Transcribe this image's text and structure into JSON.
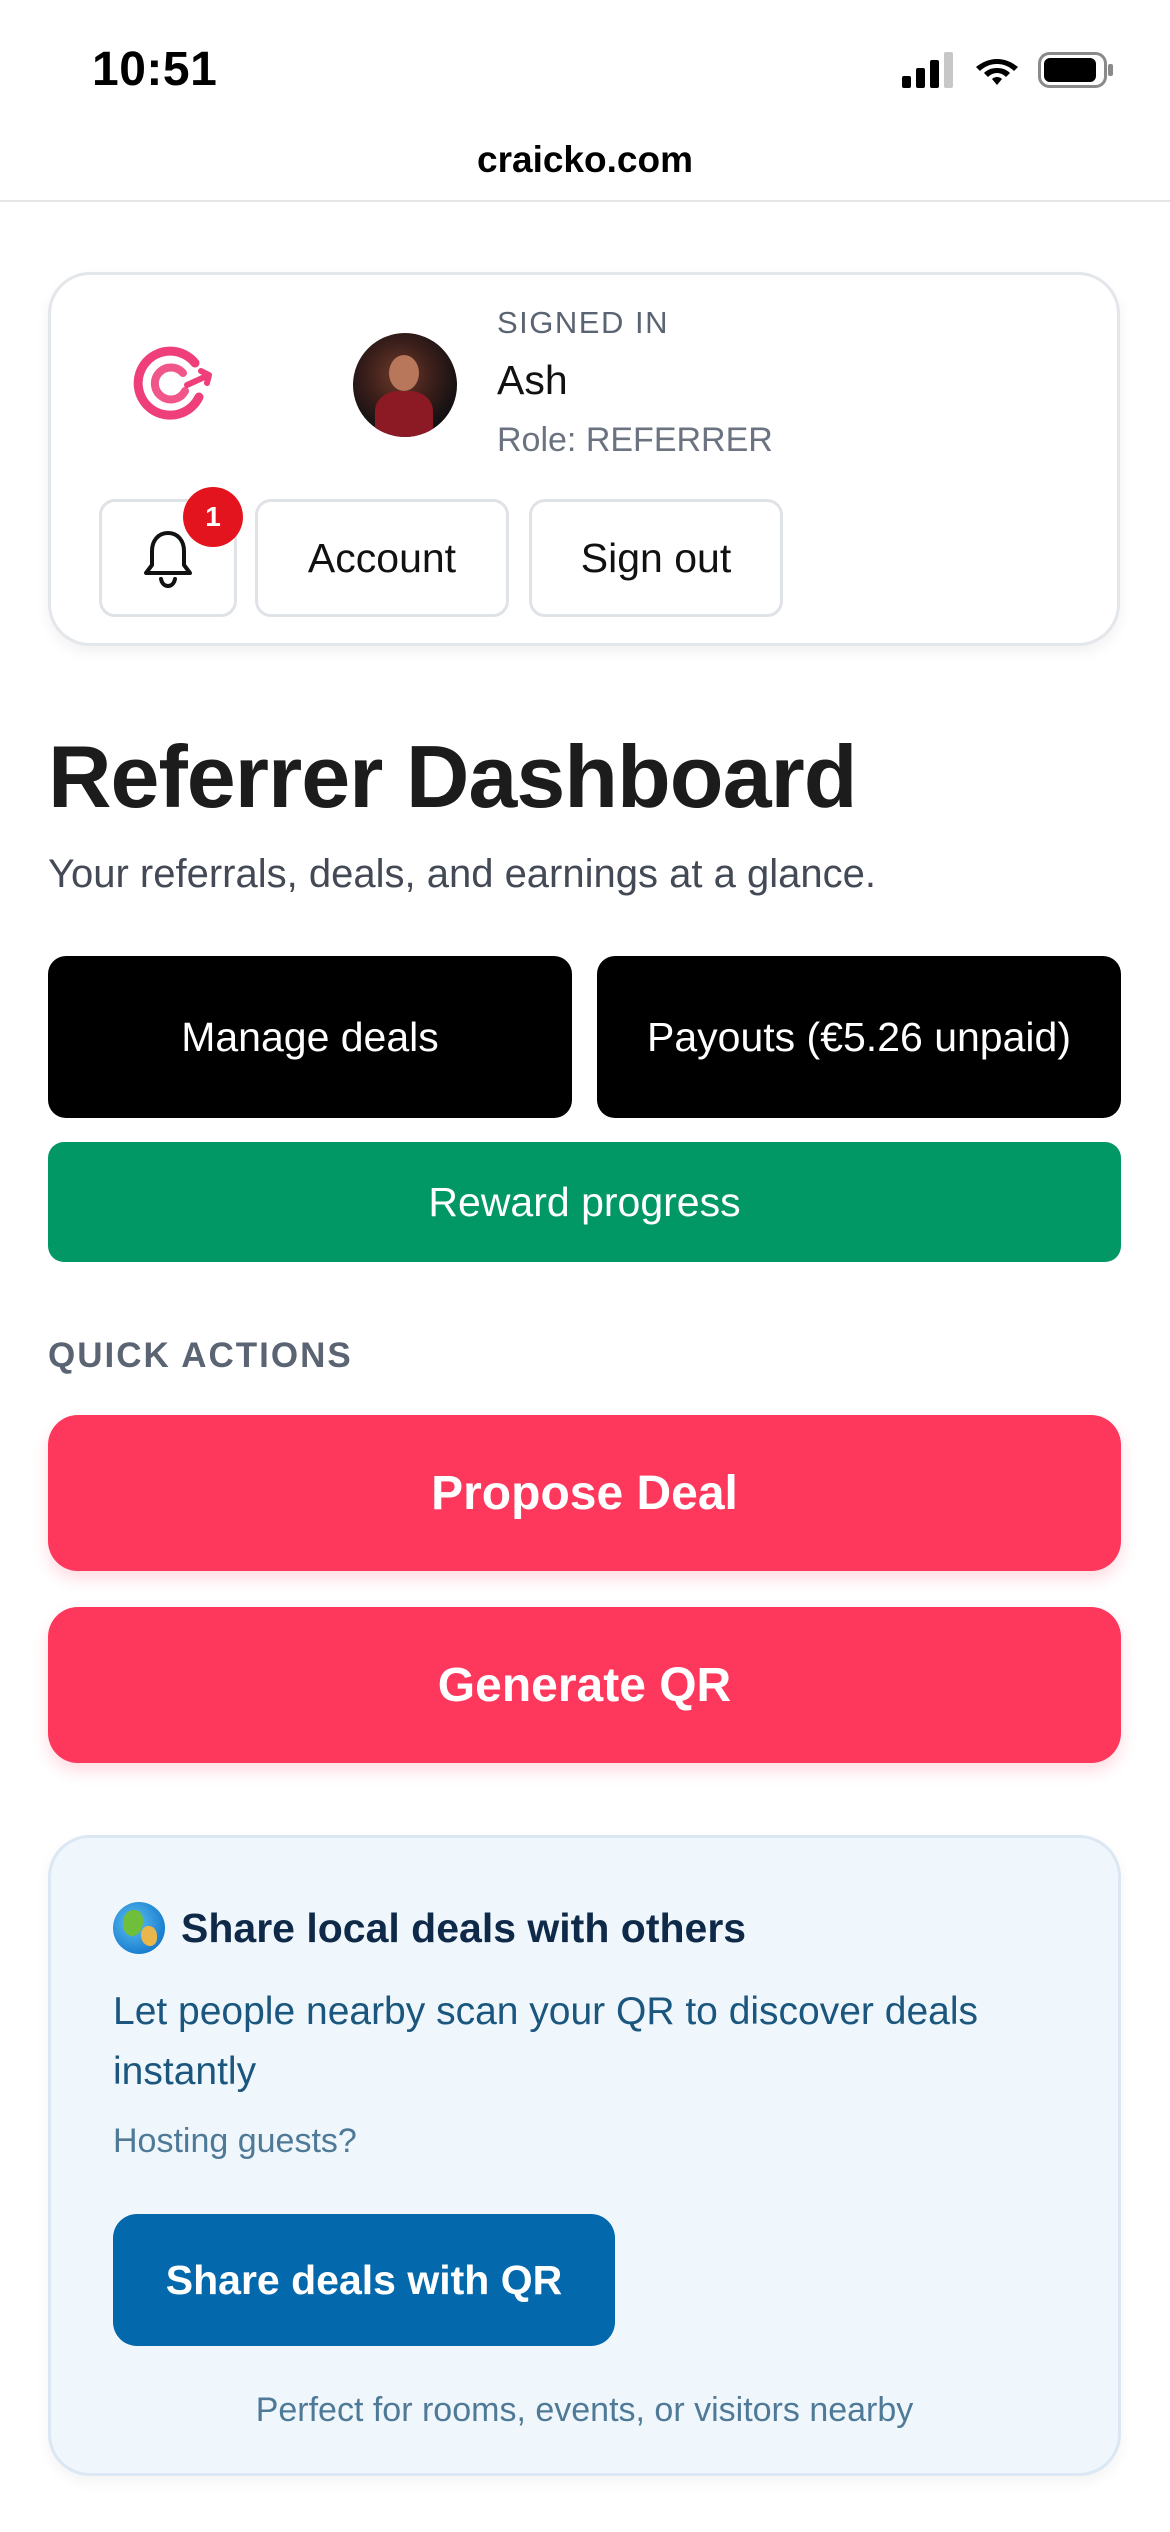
{
  "status_bar": {
    "time": "10:51"
  },
  "browser": {
    "url": "craicko.com"
  },
  "account": {
    "signed_in_label": "SIGNED IN",
    "name": "Ash",
    "role": "Role: REFERRER",
    "notification_count": "1",
    "account_button": "Account",
    "signout_button": "Sign out"
  },
  "header": {
    "title": "Referrer Dashboard",
    "subtitle": "Your referrals, deals, and earnings at a glance."
  },
  "actions": {
    "manage_deals": "Manage deals",
    "payouts": "Payouts (€5.26 unpaid)",
    "reward_progress": "Reward progress"
  },
  "quick_actions": {
    "label": "QUICK ACTIONS",
    "propose_deal": "Propose Deal",
    "generate_qr": "Generate QR"
  },
  "share_card": {
    "title": "Share local deals with others",
    "description": "Let people nearby scan your QR to discover deals instantly",
    "hint": "Hosting guests?",
    "button": "Share deals with QR",
    "footnote": "Perfect for rooms, events, or visitors nearby"
  },
  "colors": {
    "brand_pink": "#fe375d",
    "reward_green": "#029865",
    "share_blue": "#0468ad",
    "badge_red": "#e4141f"
  },
  "icons": {
    "bell": "bell-icon",
    "globe": "globe-icon",
    "logo": "craicko-logo"
  }
}
